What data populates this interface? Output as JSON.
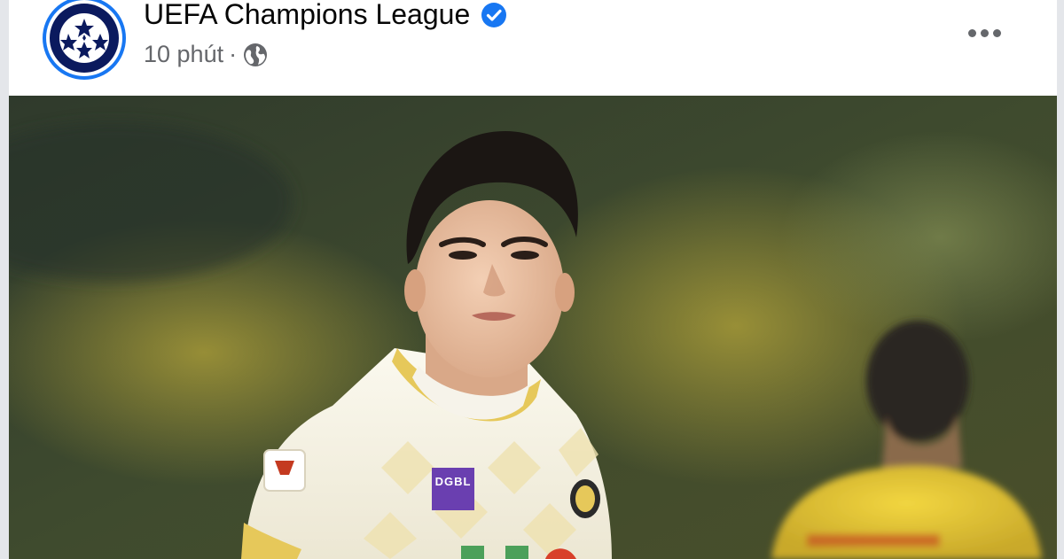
{
  "post": {
    "page_name": "UEFA Champions League",
    "time": "10 phút",
    "separator": "·",
    "avatar_icon": "champions-league-starball-icon",
    "verified_icon": "verified-badge-icon",
    "audience_icon": "globe-icon",
    "more_icon": "more-options-icon"
  },
  "photo": {
    "shirt_sponsor": "DGBL",
    "colors": {
      "player_shirt": "#f4f1e4",
      "shirt_trim": "#e6c85a",
      "background_green": "#3f4b2e",
      "background_yellow": "#b5a53a",
      "opponent_shirt": "#e8c832"
    }
  },
  "colors": {
    "accent": "#1877f2",
    "text_primary": "#050505",
    "text_secondary": "#65676b"
  }
}
